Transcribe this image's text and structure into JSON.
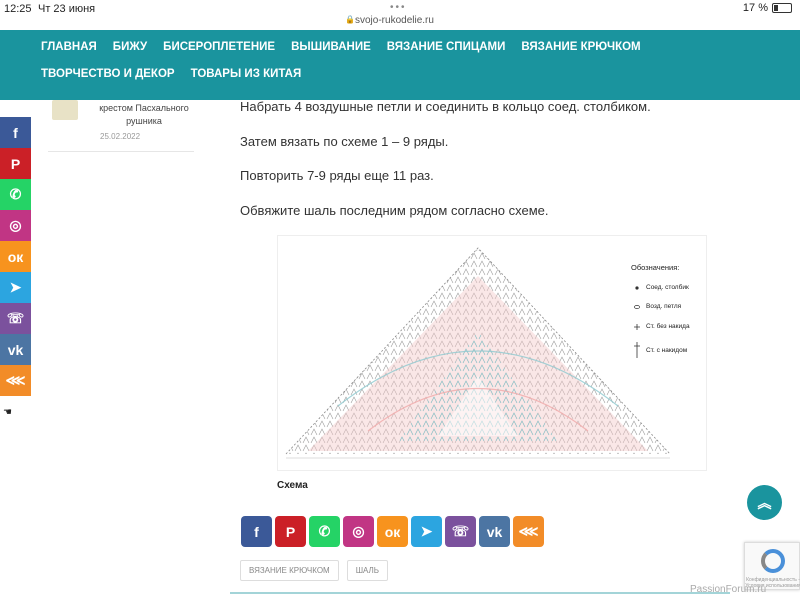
{
  "status_bar": {
    "time": "12:25",
    "date": "Чт 23 июня",
    "url": "svojo-rukodelie.ru",
    "battery": "17 %",
    "dots": "•••"
  },
  "nav": {
    "row1": [
      "ГЛАВНАЯ",
      "БИЖУ",
      "БИСЕРОПЛЕТЕНИЕ",
      "ВЫШИВАНИЕ",
      "ВЯЗАНИЕ СПИЦАМИ",
      "ВЯЗАНИЕ КРЮЧКОМ"
    ],
    "row2": [
      "ТВОРЧЕСТВО И ДЕКОР",
      "ТОВАРЫ ИЗ КИТАЯ"
    ]
  },
  "sidebar": {
    "post_caption": "крестом Пасхального рушника",
    "post_date": "25.02.2022"
  },
  "article": {
    "paragraphs": [
      "Набрать 4 воздушные петли и соединить в кольцо соед. столбиком.",
      "Затем вязать по схеме 1 – 9 ряды.",
      "Повторить 7-9 ряды еще 11 раз.",
      "Обвяжите шаль последним рядом согласно схеме."
    ],
    "diagram_caption": "Схема"
  },
  "legend": {
    "title": "Обозначения:",
    "items": [
      "Соед. столбик",
      "Возд. петля",
      "Ст. без накида",
      "Ст. с накидом"
    ]
  },
  "share_buttons": [
    {
      "name": "facebook",
      "glyph": "f",
      "color": "#3b5998"
    },
    {
      "name": "pinterest",
      "glyph": "P",
      "color": "#cb2027"
    },
    {
      "name": "whatsapp",
      "glyph": "✆",
      "color": "#25d366"
    },
    {
      "name": "instagram",
      "glyph": "◎",
      "color": "#c13584"
    },
    {
      "name": "odnoklassniki",
      "glyph": "ок",
      "color": "#f7931e"
    },
    {
      "name": "telegram",
      "glyph": "➤",
      "color": "#2ca5e0"
    },
    {
      "name": "viber",
      "glyph": "☏",
      "color": "#7b519d"
    },
    {
      "name": "vk",
      "glyph": "vk",
      "color": "#4c75a3"
    },
    {
      "name": "share",
      "glyph": "⋘",
      "color": "#f28c28"
    }
  ],
  "tags": [
    "ВЯЗАНИЕ КРЮЧКОМ",
    "ШАЛЬ"
  ],
  "recaptcha_text": "Конфиденциальность - Условия использования",
  "watermark": "PassionForum.ru",
  "colors": {
    "nav": "#1a949e",
    "accent": "#1a949e",
    "pink": "#f3c9c9",
    "teal_stitch": "#8fc9cf"
  }
}
